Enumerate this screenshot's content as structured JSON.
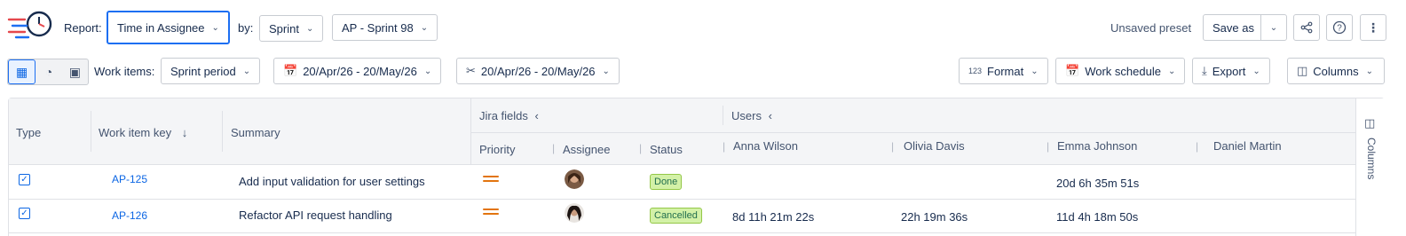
{
  "toolbar": {
    "report_label": "Report:",
    "report_value": "Time in Assignee",
    "by_label": "by:",
    "by_value": "Sprint",
    "sprint_value": "AP - Sprint 98",
    "unsaved_preset": "Unsaved preset",
    "save_as": "Save as"
  },
  "filters": {
    "work_items_label": "Work items:",
    "sprint_period": "Sprint period",
    "date_range_1": "20/Apr/26 - 20/May/26",
    "date_range_2": "20/Apr/26 - 20/May/26",
    "format": "Format",
    "format_icon_text": "123",
    "work_schedule": "Work schedule",
    "export": "Export",
    "columns": "Columns"
  },
  "table": {
    "headers": {
      "type": "Type",
      "key": "Work item key",
      "summary": "Summary",
      "jira_fields": "Jira fields",
      "users": "Users",
      "priority": "Priority",
      "assignee": "Assignee",
      "status": "Status",
      "user1": "Anna Wilson",
      "user2": "Olivia Davis",
      "user3": "Emma Johnson",
      "user4": "Daniel Martin"
    },
    "side_panel_label": "Columns",
    "rows": [
      {
        "key": "AP-125",
        "summary": "Add input validation for user settings",
        "status": "Done",
        "anna": "",
        "olivia": "",
        "emma": "20d 6h 35m 51s",
        "daniel": ""
      },
      {
        "key": "AP-126",
        "summary": "Refactor API request handling",
        "status": "Cancelled",
        "anna": "8d 11h 21m 22s",
        "olivia": "22h 19m 36s",
        "emma": "11d 4h 18m 50s",
        "daniel": ""
      }
    ]
  },
  "colors": {
    "accent": "#0c66e4",
    "focus": "#1d6ff2",
    "priority": "#e2740e",
    "lozenge_bg": "#d3f1a7"
  }
}
